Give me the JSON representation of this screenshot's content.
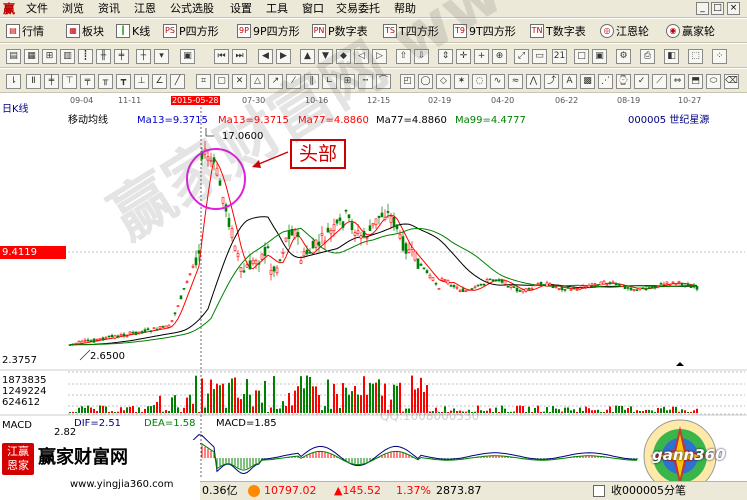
{
  "menubar": {
    "logo": "赢",
    "items": [
      "文件",
      "浏览",
      "资讯",
      "江恩",
      "公式选股",
      "设置",
      "工具",
      "窗口",
      "交易委托",
      "帮助"
    ],
    "controls": [
      "_",
      "□",
      "×"
    ]
  },
  "toolbar1": [
    "行情",
    "板块",
    "K线",
    "P四方形",
    "9P四方形",
    "P数字表",
    "T四方形",
    "9T四方形",
    "T数字表",
    "江恩轮",
    "赢家轮"
  ],
  "toolbar1_icons": [
    "PS",
    "9P",
    "PN",
    "TS",
    "T9",
    "TN"
  ],
  "chart": {
    "period_label": "日K线",
    "indicator_name": "移动均线",
    "ma_labels": [
      "Ma13=9.3715",
      "Ma13=9.3715",
      "Ma77=4.8860",
      "Ma77=4.8860",
      "Ma99=4.4777"
    ],
    "ma_colors": [
      "#0000cc",
      "#ff0000",
      "#ff0000",
      "#000000",
      "#008000"
    ],
    "stock": "000005 世纪星源",
    "dates": [
      "09-04",
      "11-11",
      "2015-05-28",
      "07-30",
      "10-16",
      "12-15",
      "02-19",
      "04-20",
      "06-22",
      "08-19",
      "10-27"
    ],
    "high_label": "17.0600",
    "current_price": "9.4119",
    "low_price_left": "2.3757",
    "low_label": "2.6500",
    "volume_ticks": [
      "1873835",
      "1249224",
      "624612"
    ],
    "annotation": "头部",
    "watermark": "赢家财富网 www.yingjia360.com",
    "qq_watermark": "QQ:1008000530"
  },
  "macd": {
    "name": "MACD",
    "dif": "DIF=2.51",
    "dea": "DEA=1.58",
    "macd": "MACD=1.85",
    "axis_tick": "2.82",
    "colors": {
      "dif": "#000080",
      "dea": "#008000"
    }
  },
  "logo": {
    "seal_text": "江赢 恩家",
    "name": "赢家财富网",
    "url": "www.yingjia360.com"
  },
  "gann_logo": "gann360",
  "statusbar": {
    "volume": "0.36亿",
    "index": "10797.02",
    "change": "▲145.52",
    "pct": "1.37%",
    "amount": "2873.87",
    "status": "收000005分笔"
  },
  "colors": {
    "accent_red": "#ff0000",
    "candle_green": "#008000",
    "toolbar_bg": "#ece9d8"
  }
}
